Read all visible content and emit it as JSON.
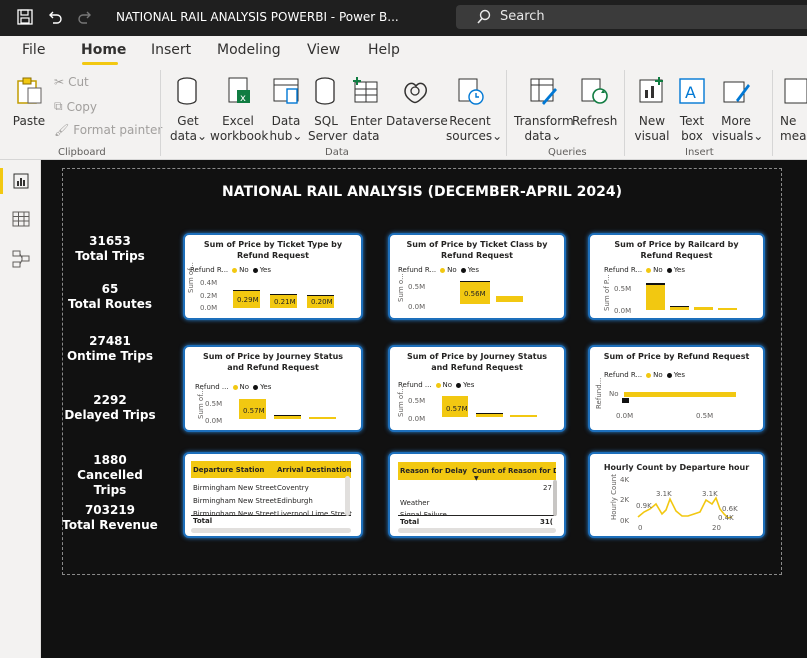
{
  "titlebar": {
    "title": "NATIONAL RAIL ANALYSIS POWERBI - Power B...",
    "search_placeholder": "Search"
  },
  "menu": {
    "file": "File",
    "home": "Home",
    "insert": "Insert",
    "modeling": "Modeling",
    "view": "View",
    "help": "Help"
  },
  "ribbon": {
    "paste": "Paste",
    "cut": "Cut",
    "copy": "Copy",
    "format_painter": "Format painter",
    "clipboard": "Clipboard",
    "get_data": [
      "Get",
      "data"
    ],
    "excel": [
      "Excel",
      "workbook"
    ],
    "data_hub": [
      "Data",
      "hub"
    ],
    "sql": [
      "SQL",
      "Server"
    ],
    "enter_data": [
      "Enter",
      "data"
    ],
    "dataverse": "Dataverse",
    "recent": [
      "Recent",
      "sources"
    ],
    "data_group": "Data",
    "transform": [
      "Transform",
      "data"
    ],
    "refresh": "Refresh",
    "queries": "Queries",
    "new_visual": [
      "New",
      "visual"
    ],
    "text_box": [
      "Text",
      "box"
    ],
    "more_visuals": [
      "More",
      "visuals"
    ],
    "insert_group": "Insert",
    "new_measure": [
      "Ne",
      "meas"
    ]
  },
  "report": {
    "title": "NATIONAL RAIL ANALYSIS (DECEMBER-APRIL 2024)",
    "kpis": [
      {
        "value": "31653",
        "label": "Total Trips"
      },
      {
        "value": "65",
        "label": "Total Routes"
      },
      {
        "value": "27481",
        "label": "Ontime Trips"
      },
      {
        "value": "2292",
        "label": "Delayed Trips"
      },
      {
        "value": "1880",
        "label": "Cancelled Trips"
      },
      {
        "value": "703219",
        "label": "Total Revenue"
      }
    ],
    "legend": {
      "no": "No",
      "yes": "Yes"
    },
    "ticket_type": {
      "title": "Sum of Price by Ticket Type by Refund Request",
      "legend_label": "Refund R...",
      "y_axis": "Sum of...",
      "ticks": [
        "0.4M",
        "0.2M",
        "0.0M"
      ],
      "bar_labels": [
        "0.29M",
        "0.21M",
        "0.20M"
      ]
    },
    "ticket_class": {
      "title": "Sum of Price by Ticket Class by Refund Request",
      "legend_label": "Refund R...",
      "y_axis": "Sum o...",
      "ticks": [
        "0.5M",
        "0.0M"
      ],
      "bar_labels": [
        "0.56M"
      ]
    },
    "railcard": {
      "title": "Sum of Price by Railcard by Refund Request",
      "legend_label": "Refund R...",
      "y_axis": "Sum of P...",
      "ticks": [
        "0.5M",
        "0.0M"
      ]
    },
    "journey1": {
      "title": "Sum of Price by Journey Status and Refund Request",
      "legend_label": "Refund ...",
      "y_axis": "Sum of...",
      "ticks": [
        "0.5M",
        "0.0M"
      ],
      "bar_labels": [
        "0.57M"
      ]
    },
    "journey2": {
      "title": "Sum of Price by Journey Status and Refund Request",
      "legend_label": "Refund ...",
      "y_axis": "Sum of...",
      "ticks": [
        "0.5M",
        "0.0M"
      ],
      "bar_labels": [
        "0.57M"
      ]
    },
    "refund": {
      "title": "Sum of Price by Refund Request",
      "legend_label": "Refund R...",
      "y_axis": "Refund...",
      "category": "No",
      "x_ticks": [
        "0.0M",
        "0.5M"
      ]
    },
    "departure_table": {
      "headers": [
        "Departure Station",
        "Arrival Destination"
      ],
      "rows": [
        [
          "Birmingham New Street",
          "Coventry"
        ],
        [
          "Birmingham New Street",
          "Edinburgh"
        ],
        [
          "Birmingham New Street",
          "Liverpool Lime Street"
        ]
      ],
      "total": "Total"
    },
    "delay_table": {
      "headers": [
        "Reason for Delay",
        "Count of Reason for De"
      ],
      "first_value": "27",
      "rows": [
        [
          "Weather",
          ""
        ],
        [
          "Signal Failure",
          ""
        ]
      ],
      "total": "Total",
      "total_value": "31("
    },
    "hourly": {
      "title": "Hourly Count by Departure hour",
      "y_axis": "Hourly Count",
      "y_ticks": [
        "4K",
        "2K",
        "0K"
      ],
      "x_ticks": [
        "0",
        "20"
      ],
      "labels": [
        "0.9K",
        "3.1K",
        "3.1K",
        "0.6K",
        "0.4K"
      ]
    }
  },
  "colors": {
    "accent": "#f2c811",
    "card_border": "#1d6fbb",
    "canvas": "#111111"
  }
}
